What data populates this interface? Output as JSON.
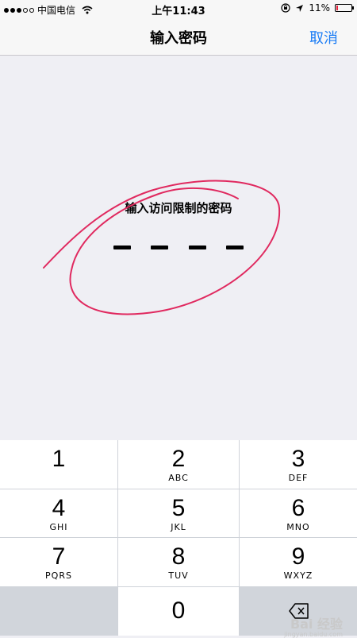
{
  "status_bar": {
    "carrier": "中国电信",
    "time": "上午11:43",
    "battery": "11%",
    "battery_level": 0.11,
    "battery_color": "#e8203a"
  },
  "nav": {
    "title": "输入密码",
    "cancel_label": "取消",
    "accent_color": "#1a7cf5"
  },
  "prompt": {
    "label": "输入访问限制的密码",
    "slot_count": 4
  },
  "annotation_color": "#e0295f",
  "keypad": {
    "keys": [
      {
        "digit": "1",
        "letters": ""
      },
      {
        "digit": "2",
        "letters": "ABC"
      },
      {
        "digit": "3",
        "letters": "DEF"
      },
      {
        "digit": "4",
        "letters": "GHI"
      },
      {
        "digit": "5",
        "letters": "JKL"
      },
      {
        "digit": "6",
        "letters": "MNO"
      },
      {
        "digit": "7",
        "letters": "PQRS"
      },
      {
        "digit": "8",
        "letters": "TUV"
      },
      {
        "digit": "9",
        "letters": "WXYZ"
      },
      {
        "digit": "0",
        "letters": ""
      }
    ],
    "delete_icon": "backspace-icon"
  },
  "watermark": {
    "brand": "Bai 经验",
    "url": "jingyan.baidu.com"
  }
}
